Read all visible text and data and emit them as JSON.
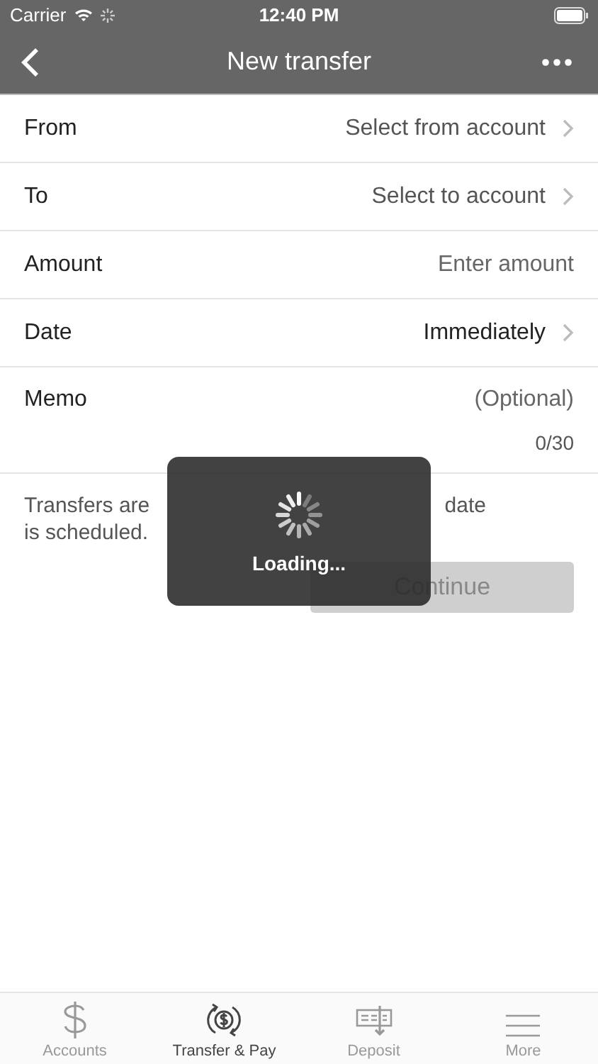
{
  "status_bar": {
    "carrier": "Carrier",
    "time": "12:40 PM"
  },
  "nav": {
    "title": "New transfer"
  },
  "fields": [
    {
      "kind": "picker",
      "label": "From",
      "placeholder": "Select from account"
    },
    {
      "kind": "picker",
      "label": "To",
      "placeholder": "Select to account"
    },
    {
      "kind": "input",
      "label": "Amount",
      "placeholder": "Enter amount"
    },
    {
      "kind": "picker",
      "label": "Date",
      "value": "Immediately"
    },
    {
      "kind": "memo",
      "label": "Memo",
      "placeholder": "(Optional)",
      "counter": "0/30"
    }
  ],
  "note": [
    "Transfers are",
    "date",
    "is scheduled."
  ],
  "continue_button": {
    "label": "Continue",
    "disabled": true
  },
  "loading": {
    "text": "Loading..."
  },
  "tabs": [
    {
      "label": "Accounts",
      "selected": false
    },
    {
      "label": "Transfer & Pay",
      "selected": true
    },
    {
      "label": "Deposit",
      "selected": false
    },
    {
      "label": "More",
      "selected": false
    }
  ]
}
